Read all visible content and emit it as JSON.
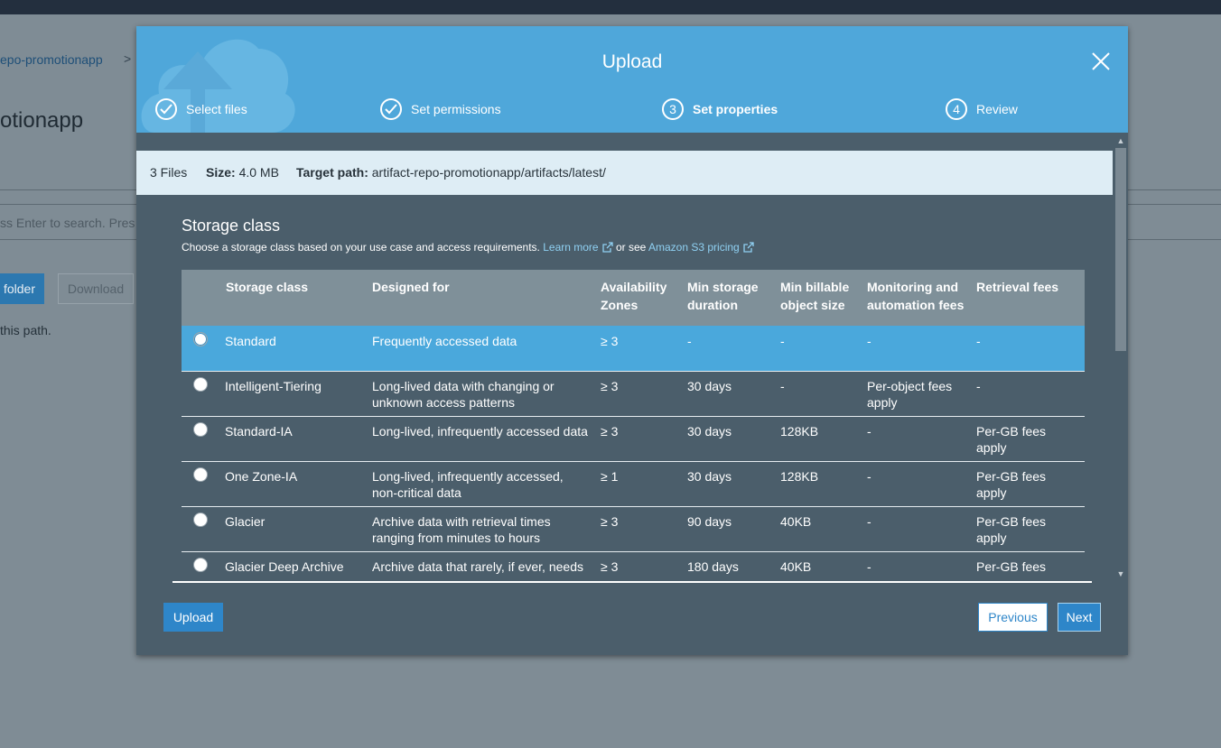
{
  "background": {
    "breadcrumb": "epo-promotionapp",
    "breadcrumb_sep": ">",
    "title": "otionapp",
    "search_placeholder": "ss Enter to search. Pres",
    "folder_button": "folder",
    "download_button": "Download",
    "path_text": "this path."
  },
  "modal": {
    "title": "Upload",
    "steps": [
      {
        "num": "",
        "label": "Select files",
        "state": "done"
      },
      {
        "num": "",
        "label": "Set permissions",
        "state": "done"
      },
      {
        "num": "3",
        "label": "Set properties",
        "state": "active"
      },
      {
        "num": "4",
        "label": "Review",
        "state": "pending"
      }
    ],
    "info": {
      "files": "3 Files",
      "size_label": "Size:",
      "size_value": "4.0 MB",
      "target_label": "Target path:",
      "target_value": "artifact-repo-promotionapp/artifacts/latest/"
    },
    "storage": {
      "title": "Storage class",
      "description": "Choose a storage class based on your use case and access requirements.",
      "learn_more": "Learn more",
      "or_see": "or see",
      "pricing_link": "Amazon S3 pricing",
      "headers": [
        "Storage class",
        "Designed for",
        "Availability Zones",
        "Min storage duration",
        "Min billable object size",
        "Monitoring and automation fees",
        "Retrieval fees"
      ],
      "rows": [
        {
          "name": "Standard",
          "designed_for": "Frequently accessed data",
          "azs": "≥ 3",
          "min_duration": "-",
          "min_size": "-",
          "monitoring": "-",
          "retrieval": "-",
          "selected": true
        },
        {
          "name": "Intelligent-Tiering",
          "designed_for": "Long-lived data with changing or unknown access patterns",
          "azs": "≥ 3",
          "min_duration": "30 days",
          "min_size": "-",
          "monitoring": "Per-object fees apply",
          "retrieval": "-",
          "selected": false
        },
        {
          "name": "Standard-IA",
          "designed_for": "Long-lived, infrequently accessed data",
          "azs": "≥ 3",
          "min_duration": "30 days",
          "min_size": "128KB",
          "monitoring": "-",
          "retrieval": "Per-GB fees apply",
          "selected": false
        },
        {
          "name": "One Zone-IA",
          "designed_for": "Long-lived, infrequently accessed, non-critical data",
          "azs": "≥ 1",
          "min_duration": "30 days",
          "min_size": "128KB",
          "monitoring": "-",
          "retrieval": "Per-GB fees apply",
          "selected": false
        },
        {
          "name": "Glacier",
          "designed_for": "Archive data with retrieval times ranging from minutes to hours",
          "azs": "≥ 3",
          "min_duration": "90 days",
          "min_size": "40KB",
          "monitoring": "-",
          "retrieval": "Per-GB fees apply",
          "selected": false
        },
        {
          "name": "Glacier Deep Archive",
          "designed_for": "Archive data that rarely, if ever, needs",
          "azs": "≥ 3",
          "min_duration": "180 days",
          "min_size": "40KB",
          "monitoring": "-",
          "retrieval": "Per-GB fees",
          "selected": false
        }
      ]
    },
    "buttons": {
      "upload": "Upload",
      "previous": "Previous",
      "next": "Next"
    }
  },
  "colors": {
    "header_blue": "#4fa7da",
    "modal_body": "#4b5e6b",
    "selected_row": "#4aa8dc",
    "primary_button": "#2e86c9"
  }
}
